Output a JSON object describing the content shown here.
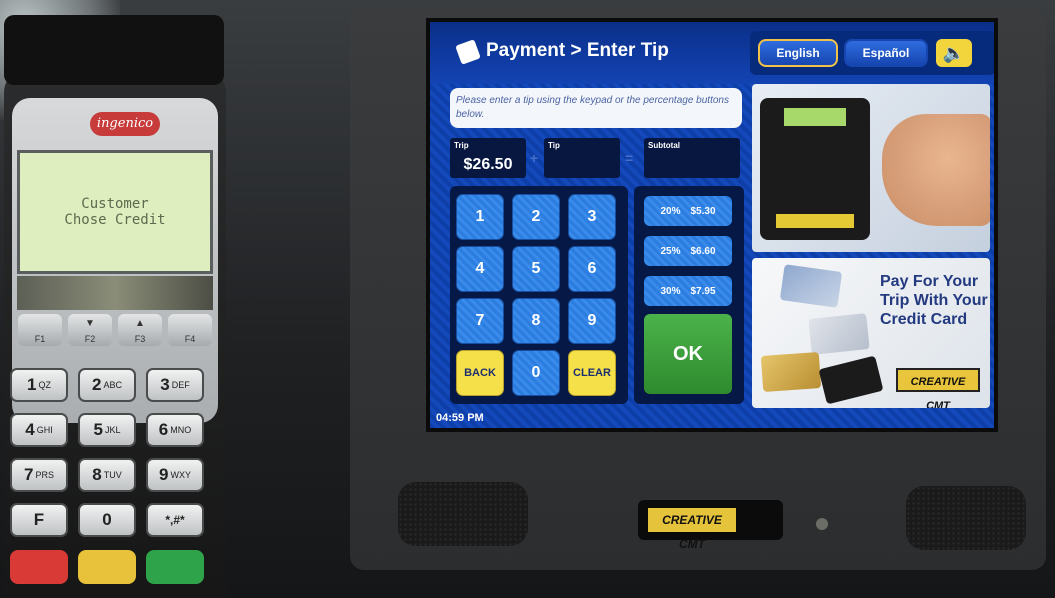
{
  "card_reader": {
    "brand": "ingenico",
    "lcd_lines": [
      "Customer",
      "Chose Credit"
    ],
    "softkeys": [
      {
        "label": "F1",
        "arrow": ""
      },
      {
        "label": "F2",
        "arrow": "▼"
      },
      {
        "label": "F3",
        "arrow": "▲"
      },
      {
        "label": "F4",
        "arrow": ""
      }
    ],
    "keys": [
      {
        "main": "1",
        "sub": "QZ"
      },
      {
        "main": "2",
        "sub": "ABC"
      },
      {
        "main": "3",
        "sub": "DEF"
      },
      {
        "main": "4",
        "sub": "GHI"
      },
      {
        "main": "5",
        "sub": "JKL"
      },
      {
        "main": "6",
        "sub": "MNO"
      },
      {
        "main": "7",
        "sub": "PRS"
      },
      {
        "main": "8",
        "sub": "TUV"
      },
      {
        "main": "9",
        "sub": "WXY"
      },
      {
        "main": "F",
        "sub": ""
      },
      {
        "main": "0",
        "sub": ""
      },
      {
        "main": "*,#*",
        "sub": ""
      }
    ],
    "color_keys": [
      "#d93a36",
      "#e8c23a",
      "#2fa34a"
    ]
  },
  "screen": {
    "header_title": "Payment > Enter Tip",
    "lang_english": "English",
    "lang_spanish": "Español",
    "speaker_glyph": "🔈",
    "instructions": "Please enter a tip using the keypad or the percentage buttons below.",
    "trip_label": "Trip",
    "trip_value": "$26.50",
    "tip_label": "Tip",
    "tip_value": "",
    "subtotal_label": "Subtotal",
    "subtotal_value": "",
    "op_plus": "+",
    "op_equals": "=",
    "keypad": [
      "1",
      "2",
      "3",
      "4",
      "5",
      "6",
      "7",
      "8",
      "9",
      "BACK",
      "0",
      "CLEAR"
    ],
    "percent_buttons": [
      {
        "pct": "20%",
        "amount": "$5.30"
      },
      {
        "pct": "25%",
        "amount": "$6.60"
      },
      {
        "pct": "30%",
        "amount": "$7.95"
      }
    ],
    "ok_label": "OK",
    "ad_headline": "Pay For Your Trip With Your Credit Card",
    "ad_logo": "CREATIVE CMT",
    "clock": "04:59 PM"
  },
  "terminal_badge": "CREATIVE CMT"
}
